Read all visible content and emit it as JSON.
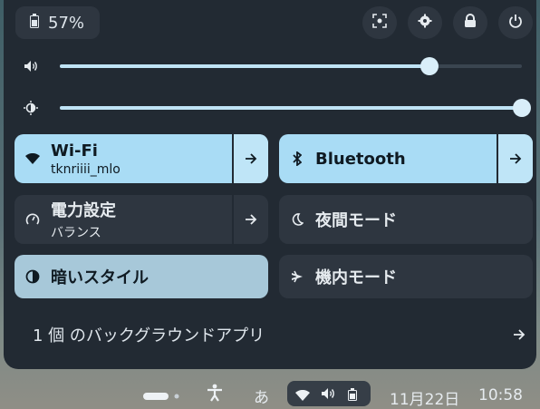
{
  "battery": {
    "percent": "57%"
  },
  "actions": {
    "screenshot": "screenshot-icon",
    "settings": "gear-icon",
    "lock": "lock-icon",
    "power": "power-icon"
  },
  "sliders": {
    "volume": {
      "icon": "speaker-icon",
      "level": 0.8
    },
    "brightness": {
      "icon": "brightness-icon",
      "level": 1.0
    }
  },
  "tiles": {
    "wifi": {
      "title": "Wi-Fi",
      "subtitle": "tknriiii_mlo"
    },
    "bluetooth": {
      "title": "Bluetooth"
    },
    "power": {
      "title": "電力設定",
      "subtitle": "バランス"
    },
    "night": {
      "title": "夜間モード"
    },
    "dark": {
      "title": "暗いスタイル"
    },
    "airplane": {
      "title": "機内モード"
    }
  },
  "background_apps": {
    "label": "1 個 のバックグラウンドアプリ"
  },
  "taskbar": {
    "input_method": "あ",
    "date": "11月22日",
    "time": "10:58"
  },
  "colors": {
    "panel": "#222a33",
    "tile_on": "#a9dcf5",
    "tile_off": "#2e3640",
    "accent": "#bfe3f5"
  }
}
